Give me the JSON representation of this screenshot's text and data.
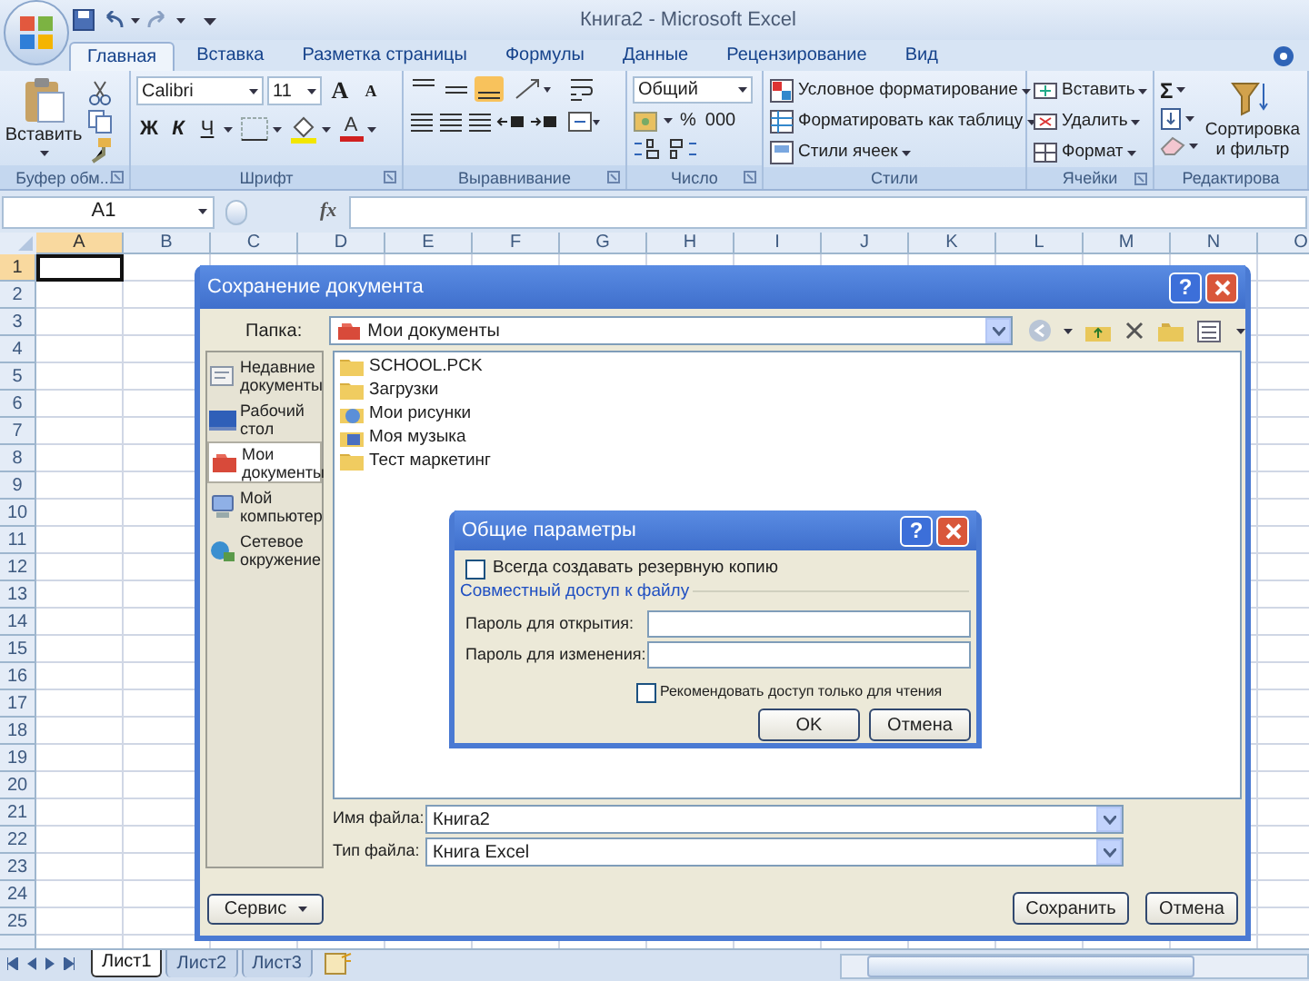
{
  "window": {
    "title": "Книга2 - Microsoft Excel"
  },
  "ribbon_tabs": [
    {
      "label": "Главная",
      "selected": true
    },
    {
      "label": "Вставка",
      "selected": false
    },
    {
      "label": "Разметка страницы",
      "selected": false
    },
    {
      "label": "Формулы",
      "selected": false
    },
    {
      "label": "Данные",
      "selected": false
    },
    {
      "label": "Рецензирование",
      "selected": false
    },
    {
      "label": "Вид",
      "selected": false
    }
  ],
  "ribbon": {
    "clipboard": {
      "paste": "Вставить",
      "label": "Буфер обм..."
    },
    "font": {
      "name": "Calibri",
      "size": "11",
      "grow": "A",
      "shrink": "A",
      "bold": "Ж",
      "italic": "К",
      "underline": "Ч",
      "font_color_letter": "A",
      "label": "Шрифт"
    },
    "alignment": {
      "label": "Выравнивание"
    },
    "number": {
      "format": "Общий",
      "percent": "%",
      "thousands": "000",
      "label": "Число"
    },
    "styles": {
      "items": [
        "Условное форматирование",
        "Форматировать как таблицу",
        "Стили ячеек"
      ],
      "label": "Стили"
    },
    "cells": {
      "items": [
        "Вставить",
        "Удалить",
        "Формат"
      ],
      "label": "Ячейки"
    },
    "editing": {
      "sum": "Σ",
      "sort": "Сортировка и фильтр",
      "label": "Редактирова"
    }
  },
  "formula_bar": {
    "name_box": "A1",
    "fx": "fx"
  },
  "columns": [
    {
      "label": "A",
      "selected": true
    },
    {
      "label": "B",
      "selected": false
    },
    {
      "label": "C",
      "selected": false
    },
    {
      "label": "D",
      "selected": false
    },
    {
      "label": "E",
      "selected": false
    },
    {
      "label": "F",
      "selected": false
    },
    {
      "label": "G",
      "selected": false
    },
    {
      "label": "H",
      "selected": false
    },
    {
      "label": "I",
      "selected": false
    },
    {
      "label": "J",
      "selected": false
    },
    {
      "label": "K",
      "selected": false
    },
    {
      "label": "L",
      "selected": false
    },
    {
      "label": "M",
      "selected": false
    },
    {
      "label": "N",
      "selected": false
    },
    {
      "label": "O",
      "selected": false
    }
  ],
  "rows": [
    {
      "label": "1",
      "selected": true
    },
    {
      "label": "2",
      "selected": false
    },
    {
      "label": "3",
      "selected": false
    },
    {
      "label": "4",
      "selected": false
    },
    {
      "label": "5",
      "selected": false
    },
    {
      "label": "6",
      "selected": false
    },
    {
      "label": "7",
      "selected": false
    },
    {
      "label": "8",
      "selected": false
    },
    {
      "label": "9",
      "selected": false
    },
    {
      "label": "10",
      "selected": false
    },
    {
      "label": "11",
      "selected": false
    },
    {
      "label": "12",
      "selected": false
    },
    {
      "label": "13",
      "selected": false
    },
    {
      "label": "14",
      "selected": false
    },
    {
      "label": "15",
      "selected": false
    },
    {
      "label": "16",
      "selected": false
    },
    {
      "label": "17",
      "selected": false
    },
    {
      "label": "18",
      "selected": false
    },
    {
      "label": "19",
      "selected": false
    },
    {
      "label": "20",
      "selected": false
    },
    {
      "label": "21",
      "selected": false
    },
    {
      "label": "22",
      "selected": false
    },
    {
      "label": "23",
      "selected": false
    },
    {
      "label": "24",
      "selected": false
    },
    {
      "label": "25",
      "selected": false
    }
  ],
  "sheet_tabs": [
    {
      "label": "Лист1",
      "selected": true
    },
    {
      "label": "Лист2",
      "selected": false
    },
    {
      "label": "Лист3",
      "selected": false
    }
  ],
  "save_dialog": {
    "title": "Сохранение документа",
    "help": "?",
    "folder_label": "Папка:",
    "folder": "Мои документы",
    "places": [
      {
        "label": "Недавние документы",
        "kind": "recent",
        "selected": false
      },
      {
        "label": "Рабочий стол",
        "kind": "desktop",
        "selected": false
      },
      {
        "label": "Мои документы",
        "kind": "documents",
        "selected": true
      },
      {
        "label": "Мой компьютер",
        "kind": "computer",
        "selected": false
      },
      {
        "label": "Сетевое окружение",
        "kind": "network",
        "selected": false
      }
    ],
    "files": [
      {
        "name": "SCHOOL.PCK",
        "kind": "folder"
      },
      {
        "name": "Загрузки",
        "kind": "folder"
      },
      {
        "name": "Мои рисунки",
        "kind": "pictures"
      },
      {
        "name": "Моя музыка",
        "kind": "music"
      },
      {
        "name": "Тест маркетинг",
        "kind": "folder"
      }
    ],
    "file_name_label": "Имя файла:",
    "file_name": "Книга2",
    "file_type_label": "Тип файла:",
    "file_type": "Книга Excel",
    "buttons": [
      "Сервис",
      "Сохранить",
      "Отмена"
    ]
  },
  "options_dialog": {
    "title": "Общие параметры",
    "help": "?",
    "backup": {
      "label": "Всегда создавать резервную копию",
      "checked": false
    },
    "group": "Совместный доступ к файлу",
    "password_open": "Пароль для открытия:",
    "password_modify": "Пароль для изменения:",
    "read_only": {
      "label": "Рекомендовать доступ только для чтения",
      "checked": false
    },
    "buttons": [
      "OK",
      "Отмена"
    ]
  }
}
